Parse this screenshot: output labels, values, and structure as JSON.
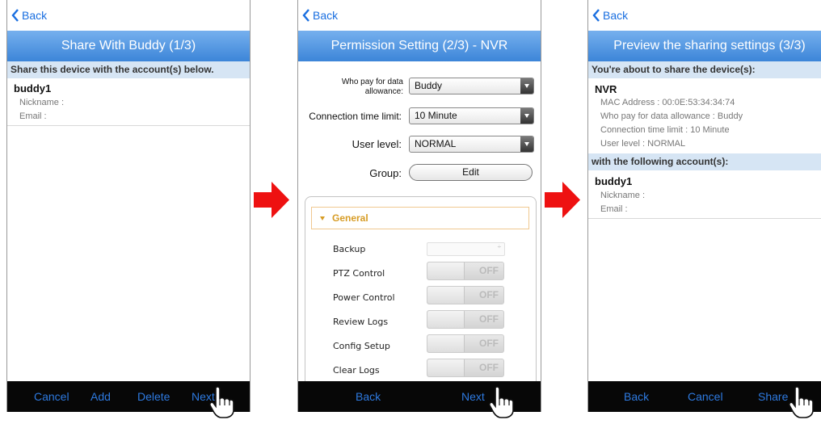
{
  "screens": [
    {
      "back_label": "Back",
      "title": "Share With Buddy (1/3)",
      "section_label": "Share this device with the account(s) below.",
      "account": {
        "name": "buddy1",
        "nickname_label": "Nickname :",
        "email_label": "Email :"
      },
      "bottom_buttons": [
        "Cancel",
        "Add",
        "Delete",
        "Next"
      ]
    },
    {
      "back_label": "Back",
      "title": "Permission Setting (2/3) - NVR",
      "who_pay_label": "Who pay for data allowance:",
      "who_pay_value": "Buddy",
      "conn_limit_label": "Connection time limit:",
      "conn_limit_value": "10 Minute",
      "user_level_label": "User level:",
      "user_level_value": "NORMAL",
      "group_label": "Group:",
      "group_button": "Edit",
      "general_label": "General",
      "permissions": [
        {
          "label": "Backup",
          "type": "select"
        },
        {
          "label": "PTZ Control",
          "type": "toggle",
          "state": "OFF"
        },
        {
          "label": "Power Control",
          "type": "toggle",
          "state": "OFF"
        },
        {
          "label": "Review Logs",
          "type": "toggle",
          "state": "OFF"
        },
        {
          "label": "Config Setup",
          "type": "toggle",
          "state": "OFF"
        },
        {
          "label": "Clear Logs",
          "type": "toggle",
          "state": "OFF"
        }
      ],
      "bottom_buttons": [
        "Back",
        "Next"
      ]
    },
    {
      "back_label": "Back",
      "title": "Preview the sharing settings (3/3)",
      "section1": "You're about to share the device(s):",
      "device_name": "NVR",
      "device_details": [
        "MAC Address : 00:0E:53:34:34:74",
        "Who pay for data allowance : Buddy",
        "Connection time limit : 10 Minute",
        "User level : NORMAL"
      ],
      "section2": "with the following account(s):",
      "account": {
        "name": "buddy1",
        "nickname_label": "Nickname :",
        "email_label": "Email :"
      },
      "bottom_buttons": [
        "Back",
        "Cancel",
        "Share"
      ]
    }
  ],
  "colors": {
    "accent": "#2e7ae0",
    "titlebar": "#4a8fdc",
    "arrow": "#ee1111",
    "section_bg": "#d6e5f4",
    "general": "#d79c25"
  }
}
